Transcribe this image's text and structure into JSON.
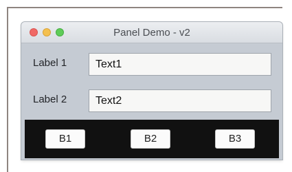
{
  "window": {
    "title": "Panel Demo - v2"
  },
  "rows": [
    {
      "label": "Label 1",
      "field_value": "Text1"
    },
    {
      "label": "Label 2",
      "field_value": "Text2"
    }
  ],
  "buttons": [
    {
      "label": "B1"
    },
    {
      "label": "B2"
    },
    {
      "label": "B3"
    }
  ],
  "colors": {
    "window_bg": "#c5cbd3",
    "button_bar_bg": "#111111",
    "close": "#f06966",
    "minimize": "#f4c04f",
    "zoom": "#5fcc58"
  }
}
